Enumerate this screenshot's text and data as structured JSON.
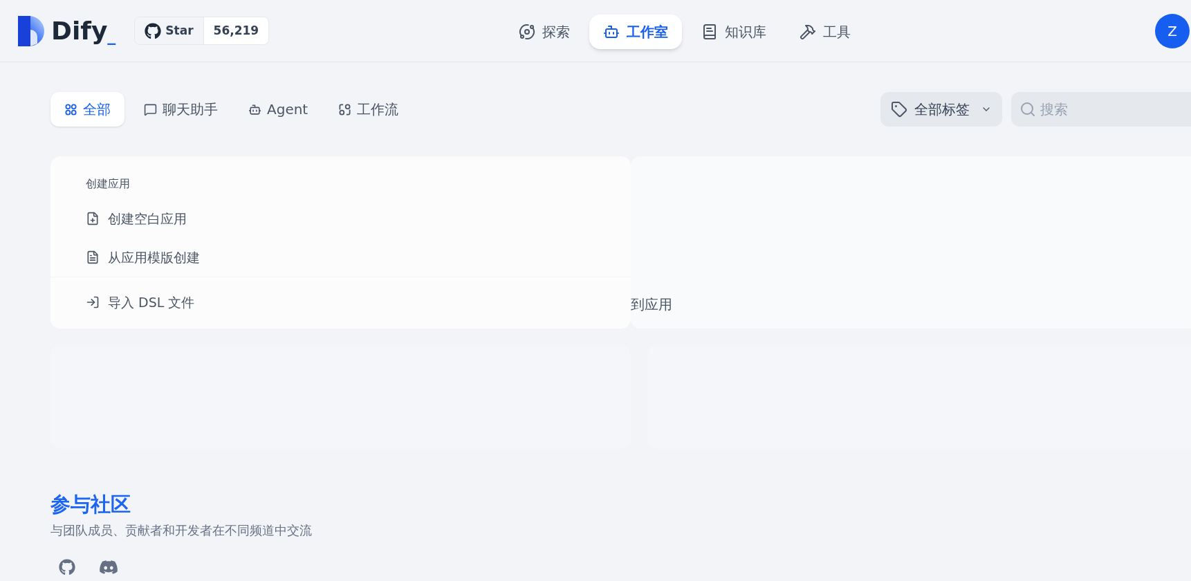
{
  "header": {
    "logo": {
      "text": "Dify",
      "cursor": "_"
    },
    "github": {
      "label": "Star",
      "count": "56,219"
    },
    "nav": [
      {
        "kind": "explore",
        "label": "探索",
        "selected": false
      },
      {
        "kind": "studio",
        "label": "工作室",
        "selected": true
      },
      {
        "kind": "knowledge",
        "label": "知识库",
        "selected": false
      },
      {
        "kind": "tools",
        "label": "工具",
        "selected": false
      }
    ],
    "avatar": "Z"
  },
  "filters": {
    "tabs": [
      {
        "kind": "all",
        "label": "全部",
        "selected": true
      },
      {
        "kind": "chat",
        "label": "聊天助手",
        "selected": false
      },
      {
        "kind": "agent",
        "label": "Agent",
        "selected": false
      },
      {
        "kind": "workflow",
        "label": "工作流",
        "selected": false
      }
    ],
    "tag_filter": "全部标签",
    "search": {
      "placeholder": "搜索"
    }
  },
  "create_card": {
    "title": "创建应用",
    "items": [
      {
        "kind": "blank",
        "label": "创建空白应用"
      },
      {
        "kind": "template",
        "label": "从应用模版创建"
      },
      {
        "kind": "import",
        "label": "导入 DSL 文件"
      }
    ]
  },
  "second_card": {
    "text": "到应用"
  },
  "community": {
    "title": "参与社区",
    "subtitle": "与团队成员、贡献者和开发者在不同频道中交流",
    "links": [
      {
        "kind": "github"
      },
      {
        "kind": "discord"
      }
    ]
  }
}
